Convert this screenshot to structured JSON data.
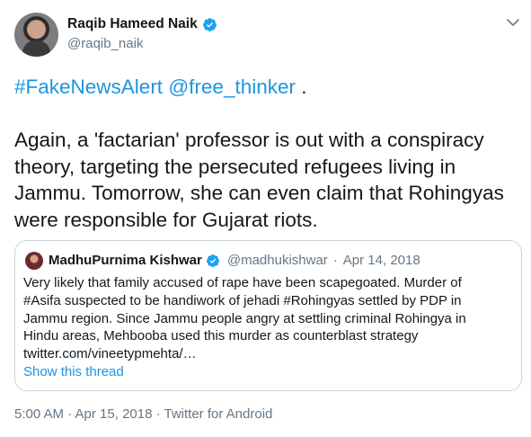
{
  "author": {
    "name": "Raqib Hameed Naik",
    "handle": "@raqib_naik"
  },
  "tweet": {
    "link_hashtag": "#FakeNewsAlert",
    "link_mention": "@free_thinker",
    "line1_tail": " .",
    "body": "Again, a 'factarian' professor is out with a conspiracy theory, targeting the persecuted refugees living in Jammu. Tomorrow, she can even claim that Rohingyas were responsible for Gujarat riots."
  },
  "quoted": {
    "name": "MadhuPurnima Kishwar",
    "handle": "@madhukishwar",
    "separator": "·",
    "date": "Apr 14, 2018",
    "text_lines": [
      "Very likely that family accused of rape have been scapegoated. Murder of",
      "#Asifa suspected to be handiwork of jehadi #Rohingyas settled by PDP in",
      "Jammu region. Since Jammu people angry at settling criminal Rohingya in",
      "Hindu areas, Mehbooba used this murder as counterblast strategy",
      "twitter.com/vineetypmehta/…"
    ],
    "show_thread": "Show this thread"
  },
  "footer": {
    "meta": "5:00 AM · Apr 15, 2018 · Twitter for Android"
  },
  "colors": {
    "link": "#1b95e0",
    "secondary": "#657786",
    "verified": "#1da1f2"
  }
}
